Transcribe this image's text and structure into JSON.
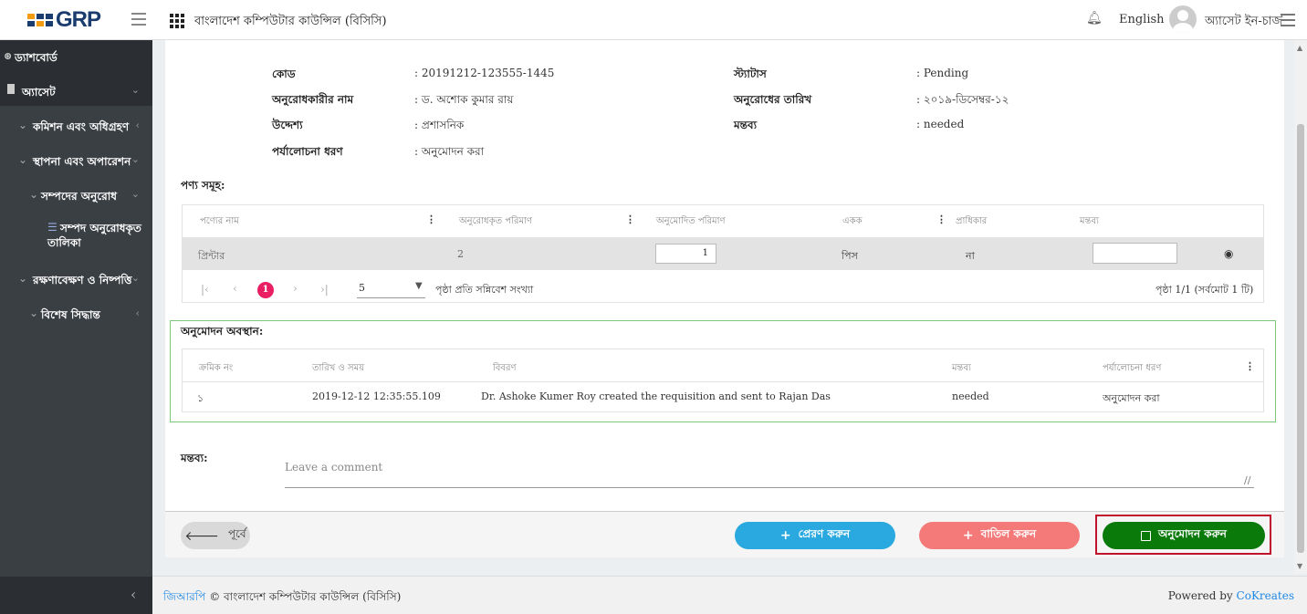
{
  "header": {
    "logo_text": "GRP",
    "org_name": "বাংলাদেশ কম্পিউটার কাউন্সিল (বিসিসি)",
    "language": "English",
    "user_name": "অ্যাসেট ইন-চার্জ"
  },
  "sidebar": {
    "items": [
      {
        "label": "ড্যাশবোর্ড",
        "icon": "dashboard-icon"
      },
      {
        "label": "অ্যাসেট",
        "chevron": "⌄"
      },
      {
        "label": "কমিশন এবং অধিগ্রহণ",
        "chevron": "‹"
      },
      {
        "label": "স্থাপনা এবং অপারেশন",
        "chevron": "⌄"
      },
      {
        "label": "সম্পদের অনুরোধ",
        "chevron": "⌄"
      },
      {
        "label": "সম্পদ অনুরোধকৃত তালিকা"
      },
      {
        "label": "রক্ষণাবেক্ষণ ও নিষ্পত্তি",
        "chevron": "⌄"
      },
      {
        "label": "বিশেষ সিদ্ধান্ত",
        "chevron": "‹"
      }
    ]
  },
  "info": {
    "code_label": "কোড",
    "code_value": ": 20191212-123555-1445",
    "requester_label": "অনুরোধকারীর নাম",
    "requester_value": ": ড. অশোক কুমার রায়",
    "purpose_label": "উদ্দেশ্য",
    "purpose_value": ": প্রশাসনিক",
    "review_label": "পর্যালোচনা ধরণ",
    "review_value": ": অনুমোদন করা",
    "status_label": "স্ট্যাটাস",
    "status_value": ": Pending",
    "date_label": "অনুরোধের তারিখ",
    "date_value": ": ২০১৯-ডিসেম্বর-১২",
    "remark_label": "মন্তব্য",
    "remark_value": ": needed"
  },
  "products": {
    "title": "পণ্য সমূহ:",
    "headers": [
      "পণ্যের নাম",
      "অনুরোধকৃত পরিমাণ",
      "অনুমোদিত পরিমাণ",
      "একক",
      "প্রাধিকার",
      "মন্তব্য"
    ],
    "row": {
      "name": "প্রিন্টার",
      "requested": "2",
      "approved": "1",
      "unit": "পিস",
      "priority": "না",
      "comment": ""
    },
    "pager": {
      "first": "|‹",
      "prev": "‹",
      "page": "1",
      "next": "›",
      "last": "›|",
      "per_page": "5",
      "per_page_label": "পৃষ্ঠা প্রতি সন্নিবেশ সংখ্যা",
      "summary": "পৃষ্ঠা 1/1 (সর্বমোট 1 টি)"
    }
  },
  "approval": {
    "title": "অনুমোদন অবস্থান:",
    "headers": [
      "ক্রমিক নং",
      "তারিখ ও সময়",
      "বিবরণ",
      "মন্তব্য",
      "পর্যালোচনা ধরণ"
    ],
    "row": {
      "serial": "১",
      "datetime": "2019-12-12 12:35:55.109",
      "description": "Dr. Ashoke Kumer Roy created the requisition and sent to Rajan Das",
      "comment": "needed",
      "review": "অনুমোদন করা"
    }
  },
  "comment": {
    "label": "মন্তব্য:",
    "placeholder": "Leave a comment"
  },
  "actions": {
    "prev": "পূর্বে",
    "send": "প্রেরণ করুন",
    "cancel": "বাতিল করুন",
    "approve": "অনুমোদন করুন"
  },
  "footer": {
    "brand": "জিআরপি",
    "copyright": "© বাংলাদেশ কম্পিউটার কাউন্সিল (বিসিসি)",
    "powered_by": "Powered by",
    "company": "CoKreates"
  },
  "colors": {
    "send": "#29a9e0",
    "cancel": "#f47a7a",
    "approve": "#0a7a0a",
    "highlight": "#c0122b",
    "active_page": "#e91e63"
  }
}
